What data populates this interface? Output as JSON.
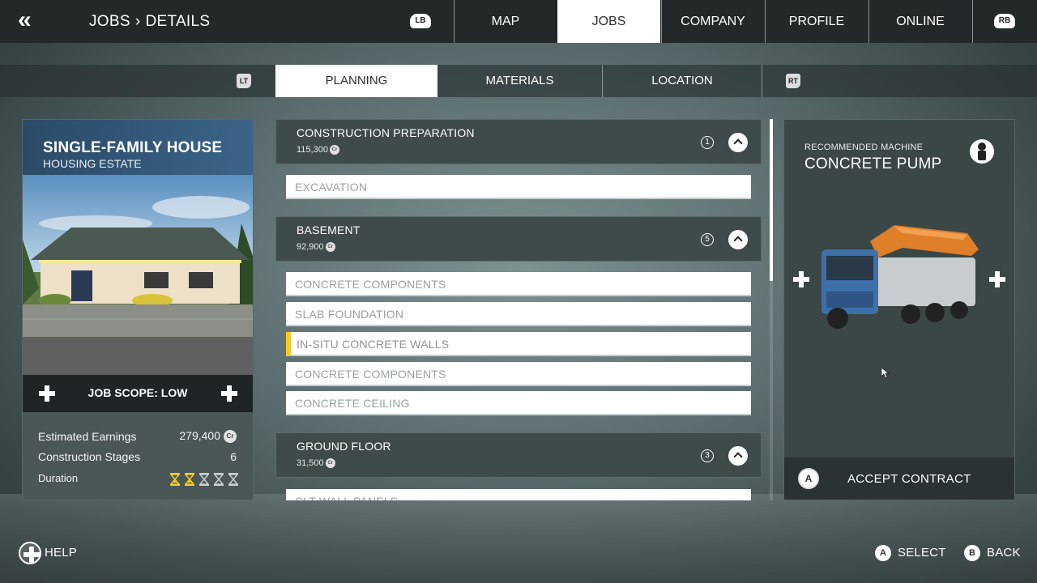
{
  "topbar": {
    "breadcrumb": [
      "JOBS",
      "DETAILS"
    ],
    "breadcrumb_sep": "›",
    "bumper_left": "LB",
    "bumper_right": "RB",
    "tabs": [
      {
        "label": "MAP",
        "active": false
      },
      {
        "label": "JOBS",
        "active": true
      },
      {
        "label": "COMPANY",
        "active": false
      },
      {
        "label": "PROFILE",
        "active": false
      },
      {
        "label": "ONLINE",
        "active": false
      }
    ]
  },
  "subtabs": {
    "trigger_left": "LT",
    "trigger_right": "RT",
    "tabs": [
      {
        "label": "PLANNING",
        "active": true
      },
      {
        "label": "MATERIALS",
        "active": false
      },
      {
        "label": "LOCATION",
        "active": false
      }
    ]
  },
  "job": {
    "title": "SINGLE-FAMILY HOUSE",
    "subtitle": "HOUSING ESTATE",
    "scope_label": "JOB SCOPE: LOW",
    "stats": {
      "earnings_label": "Estimated Earnings",
      "earnings_value": "279,400",
      "stages_label": "Construction Stages",
      "stages_value": "6",
      "duration_label": "Duration",
      "duration_filled": 2,
      "duration_total": 5
    },
    "currency_icon": "Cr"
  },
  "stages": [
    {
      "name": "CONSTRUCTION PREPARATION",
      "cost": "115,300",
      "count": "1",
      "tasks": [
        {
          "label": "EXCAVATION",
          "selected": false
        }
      ]
    },
    {
      "name": "BASEMENT",
      "cost": "92,900",
      "count": "5",
      "tasks": [
        {
          "label": "CONCRETE COMPONENTS",
          "selected": false
        },
        {
          "label": "SLAB FOUNDATION",
          "selected": false
        },
        {
          "label": "IN-SITU CONCRETE WALLS",
          "selected": true
        },
        {
          "label": "CONCRETE COMPONENTS",
          "selected": false
        },
        {
          "label": "CONCRETE CEILING",
          "selected": false
        }
      ]
    },
    {
      "name": "GROUND FLOOR",
      "cost": "31,500",
      "count": "3",
      "tasks": [
        {
          "label": "CLT WALL PANELS",
          "selected": false
        }
      ]
    }
  ],
  "machine": {
    "label": "RECOMMENDED MACHINE",
    "name": "CONCRETE PUMP",
    "accept_button_glyph": "A",
    "accept_label": "ACCEPT CONTRACT"
  },
  "hints": {
    "help": "HELP",
    "select_glyph": "A",
    "select": "SELECT",
    "back_glyph": "B",
    "back": "BACK"
  },
  "colors": {
    "accent_selected": "#f0cc25",
    "header_blue": "#3b6488",
    "hourglass_active": "#f0cc25",
    "hourglass_inactive": "#c8cdcf"
  }
}
